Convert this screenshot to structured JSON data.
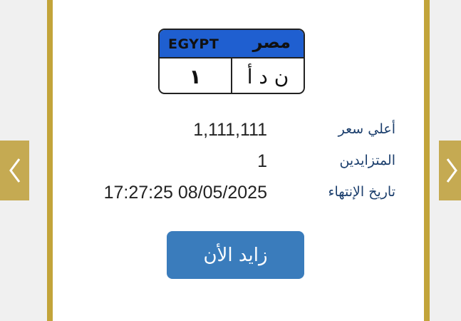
{
  "plate": {
    "country_en": "EGYPT",
    "country_ar": "مصر",
    "number": "١",
    "letters": "ن د أ"
  },
  "details": [
    {
      "label": "أعلي سعر",
      "value": "1,111,111"
    },
    {
      "label": "المتزايدين",
      "value": "1"
    },
    {
      "label": "تاريخ الإنتهاء",
      "value": "17:27:25 08/05/2025"
    }
  ],
  "bid_button": "زايد الأن",
  "colors": {
    "gold": "#c2a43a",
    "plate_blue": "#1f5fd0",
    "button_blue": "#3a7cbc",
    "label_blue": "#1c3f6d"
  },
  "icons": {
    "prev": "chevron-left-icon",
    "next": "chevron-right-icon"
  }
}
